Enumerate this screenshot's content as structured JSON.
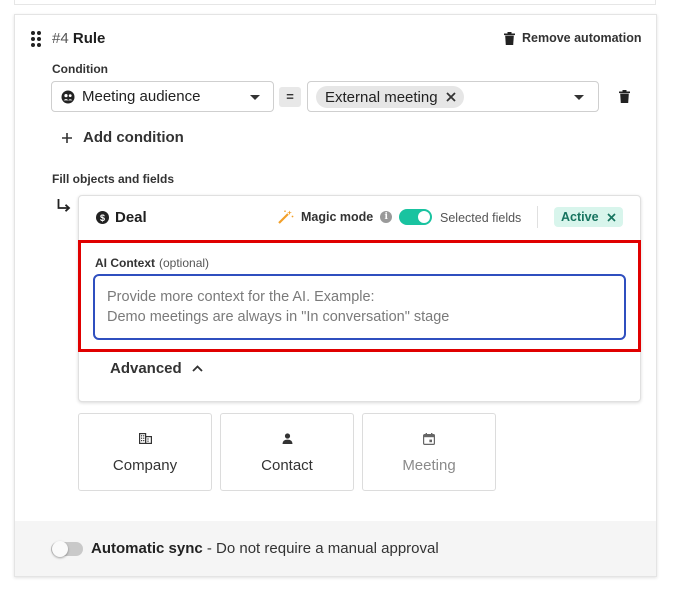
{
  "rule": {
    "number": "#4",
    "name": "Rule",
    "remove_label": "Remove automation"
  },
  "condition": {
    "label": "Condition",
    "field_value": "Meeting audience",
    "operator": "=",
    "value_chip": "External meeting",
    "add_label": "Add condition"
  },
  "fill": {
    "label": "Fill objects and fields",
    "object_name": "Deal",
    "magic_mode_label": "Magic mode",
    "magic_mode_on": true,
    "selected_fields_label": "Selected fields",
    "status_badge": "Active"
  },
  "ai_context": {
    "label": "AI Context",
    "optional": "(optional)",
    "placeholder": "Provide more context for the AI. Example:\nDemo meetings are always in \"In conversation\" stage"
  },
  "advanced": {
    "label": "Advanced"
  },
  "objects": [
    {
      "label": "Company",
      "icon": "building-icon",
      "enabled": true
    },
    {
      "label": "Contact",
      "icon": "person-icon",
      "enabled": true
    },
    {
      "label": "Meeting",
      "icon": "calendar-icon",
      "enabled": false
    }
  ],
  "sync": {
    "title": "Automatic sync",
    "description": " - Do not require a manual approval",
    "enabled": false
  },
  "colors": {
    "accent_toggle": "#19c3a0",
    "active_badge_bg": "#d8f5ec",
    "active_badge_text": "#16745f",
    "highlight_border": "#e00000",
    "input_focus_border": "#2f4fbf"
  }
}
